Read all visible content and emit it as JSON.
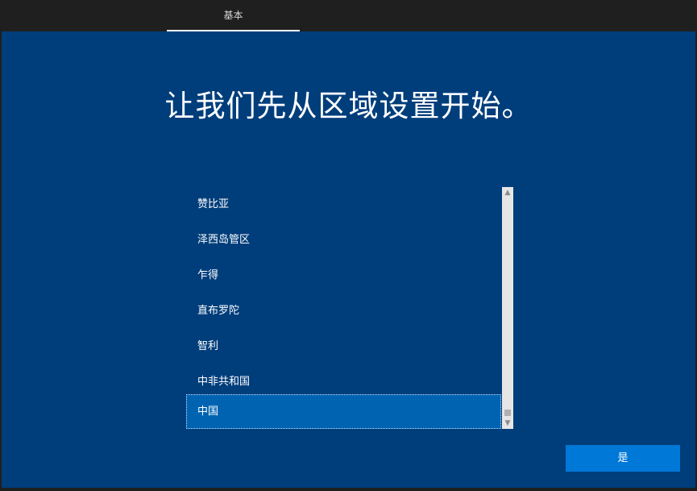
{
  "header": {
    "tabs": [
      {
        "label": "基本",
        "active": true
      }
    ]
  },
  "main": {
    "title": "让我们先从区域设置开始。",
    "region_list": {
      "items": [
        {
          "label": "赞比亚",
          "selected": false
        },
        {
          "label": "泽西岛管区",
          "selected": false
        },
        {
          "label": "乍得",
          "selected": false
        },
        {
          "label": "直布罗陀",
          "selected": false
        },
        {
          "label": "智利",
          "selected": false
        },
        {
          "label": "中非共和国",
          "selected": false
        },
        {
          "label": "中国",
          "selected": true
        }
      ]
    },
    "next_button_label": "是"
  },
  "colors": {
    "background": "#003e7b",
    "topbar": "#1f1f1f",
    "selected_item": "#0063b1",
    "button": "#0078d7"
  }
}
